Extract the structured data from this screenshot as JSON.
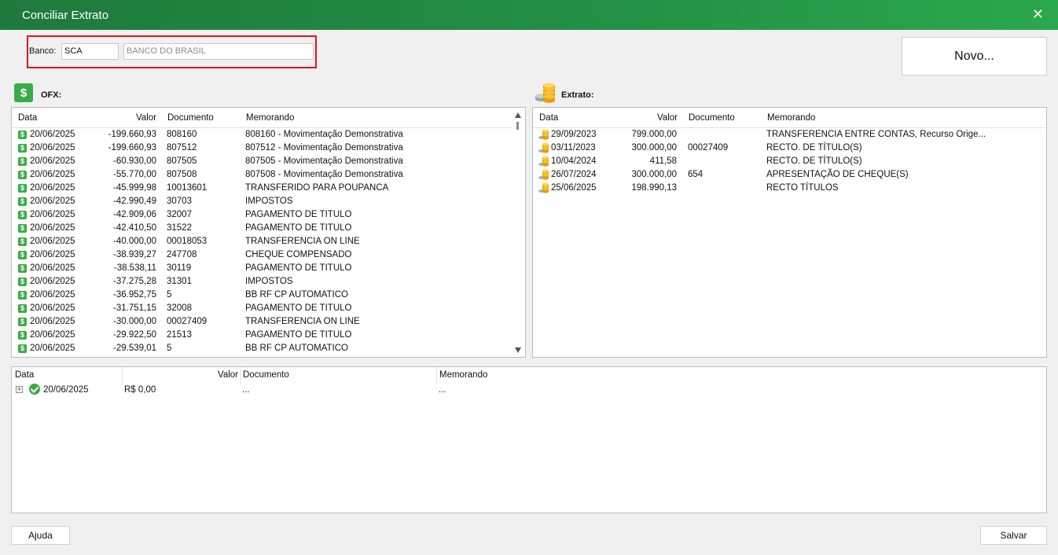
{
  "window": {
    "title": "Conciliar Extrato",
    "close_glyph": "✕"
  },
  "bank": {
    "label": "Banco:",
    "code": "SCA",
    "name": "BANCO DO BRASIL"
  },
  "buttons": {
    "novo": "Novo...",
    "ajuda": "Ajuda",
    "salvar": "Salvar"
  },
  "ofx": {
    "title": "OFX:",
    "icon": "dollar-icon",
    "columns": [
      "Data",
      "Valor",
      "Documento",
      "Memorando"
    ],
    "rows": [
      [
        "20/06/2025",
        "-199.660,93",
        "808160",
        "808160 - Movimentação Demonstrativa"
      ],
      [
        "20/06/2025",
        "-199.660,93",
        "807512",
        "807512 - Movimentação Demonstrativa"
      ],
      [
        "20/06/2025",
        "-60.930,00",
        "807505",
        "807505 - Movimentação Demonstrativa"
      ],
      [
        "20/06/2025",
        "-55.770,00",
        "807508",
        "807508 - Movimentação Demonstrativa"
      ],
      [
        "20/06/2025",
        "-45.999,98",
        "10013601",
        "TRANSFERIDO PARA POUPANCA"
      ],
      [
        "20/06/2025",
        "-42.990,49",
        "30703",
        "IMPOSTOS"
      ],
      [
        "20/06/2025",
        "-42.909,06",
        "32007",
        "PAGAMENTO DE TITULO"
      ],
      [
        "20/06/2025",
        "-42.410,50",
        "31522",
        "PAGAMENTO DE TITULO"
      ],
      [
        "20/06/2025",
        "-40.000,00",
        "00018053",
        "TRANSFERENCIA ON LINE"
      ],
      [
        "20/06/2025",
        "-38.939,27",
        "247708",
        "CHEQUE COMPENSADO"
      ],
      [
        "20/06/2025",
        "-38.538,11",
        "30119",
        "PAGAMENTO DE TITULO"
      ],
      [
        "20/06/2025",
        "-37.275,28",
        "31301",
        "IMPOSTOS"
      ],
      [
        "20/06/2025",
        "-36.952,75",
        "5",
        "BB RF CP AUTOMATICO"
      ],
      [
        "20/06/2025",
        "-31.751,15",
        "32008",
        "PAGAMENTO DE TITULO"
      ],
      [
        "20/06/2025",
        "-30.000,00",
        "00027409",
        "TRANSFERENCIA ON LINE"
      ],
      [
        "20/06/2025",
        "-29.922,50",
        "21513",
        "PAGAMENTO DE TITULO"
      ],
      [
        "20/06/2025",
        "-29.539,01",
        "5",
        "BB RF CP AUTOMATICO"
      ]
    ]
  },
  "extrato": {
    "title": "Extrato:",
    "icon": "coins-icon",
    "columns": [
      "Data",
      "Valor",
      "Documento",
      "Memorando"
    ],
    "rows": [
      [
        "29/09/2023",
        "799.000,00",
        "",
        "TRANSFERENCIA ENTRE CONTAS, Recurso Orige..."
      ],
      [
        "03/11/2023",
        "300.000,00",
        "00027409",
        "RECTO. DE TÍTULO(S)"
      ],
      [
        "10/04/2024",
        "411,58",
        "",
        "RECTO. DE TÍTULO(S)"
      ],
      [
        "26/07/2024",
        "300.000,00",
        "654",
        "APRESENTAÇÃO DE CHEQUE(S)"
      ],
      [
        "25/06/2025",
        "198.990,13",
        "",
        "RECTO TÍTULOS"
      ]
    ]
  },
  "conciliation": {
    "columns": [
      "Data",
      "Valor",
      "Documento",
      "Memorando"
    ],
    "rows": [
      {
        "data": "20/06/2025",
        "valor": "R$ 0,00",
        "documento": "...",
        "memorando": "..."
      }
    ]
  },
  "colors": {
    "titlebar": "#239145",
    "highlight_border": "#e0141a",
    "icon_green": "#3aab48",
    "coin_gold": "#f2b21b"
  }
}
